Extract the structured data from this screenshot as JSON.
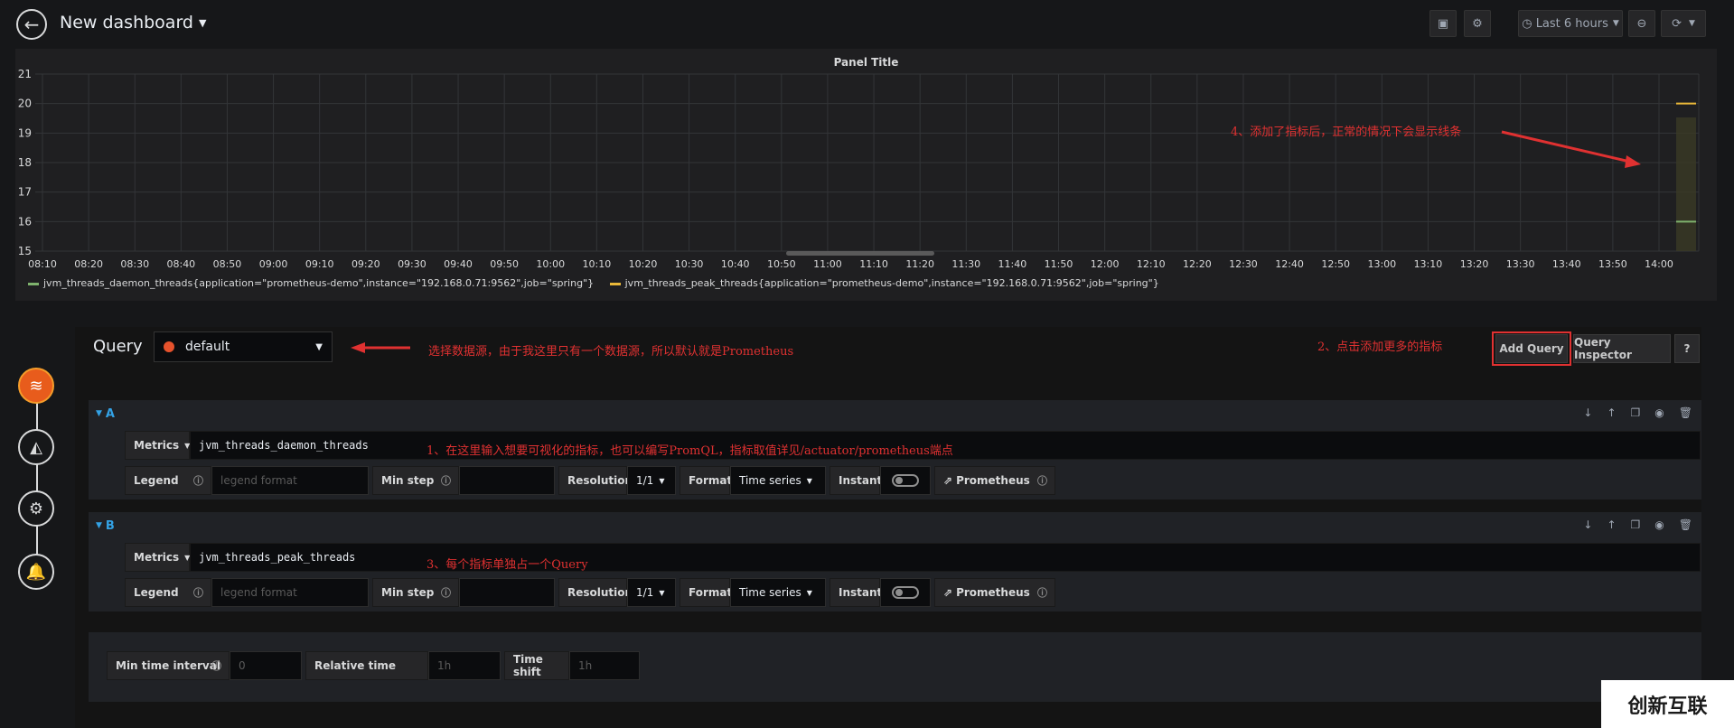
{
  "topbar": {
    "title": "New dashboard",
    "time_range": "Last 6 hours"
  },
  "panel": {
    "title": "Panel Title"
  },
  "chart_data": {
    "type": "line",
    "x": [
      "08:10",
      "08:20",
      "08:30",
      "08:40",
      "08:50",
      "09:00",
      "09:10",
      "09:20",
      "09:30",
      "09:40",
      "09:50",
      "10:00",
      "10:10",
      "10:20",
      "10:30",
      "10:40",
      "10:50",
      "11:00",
      "11:10",
      "11:20",
      "11:30",
      "11:40",
      "11:50",
      "12:00",
      "12:10",
      "12:20",
      "12:30",
      "12:40",
      "12:50",
      "13:00",
      "13:10",
      "13:20",
      "13:30",
      "13:40",
      "13:50",
      "14:00"
    ],
    "ylim": [
      15,
      21
    ],
    "yticks": [
      15,
      16,
      17,
      18,
      19,
      20,
      21
    ],
    "grid": true,
    "legend_position": "bottom",
    "series": [
      {
        "name": "jvm_threads_daemon_threads{application=\"prometheus-demo\",instance=\"192.168.0.71:9562\",job=\"spring\"}",
        "color": "#7eb26d",
        "values": [
          16,
          16
        ]
      },
      {
        "name": "jvm_threads_peak_threads{application=\"prometheus-demo\",instance=\"192.168.0.71:9562\",job=\"spring\"}",
        "color": "#eab839",
        "values": [
          20,
          20
        ]
      }
    ]
  },
  "annotations": {
    "chart_note": "4、添加了指标后，正常的情况下会显示线条",
    "datasource_note": "选择数据源，由于我这里只有一个数据源，所以默认就是Prometheus",
    "add_query_note": "2、点击添加更多的指标",
    "metrics_note": "1、在这里输入想要可视化的指标，也可以编写PromQL，指标取值详见/actuator/prometheus端点",
    "query_note": "3、每个指标单独占一个Query"
  },
  "editor": {
    "query_label": "Query",
    "datasource": "default",
    "add_query": "Add Query",
    "query_inspector": "Query Inspector",
    "help": "?"
  },
  "labels": {
    "metrics": "Metrics",
    "legend": "Legend",
    "legend_placeholder": "legend format",
    "min_step": "Min step",
    "resolution": "Resolution",
    "format": "Format",
    "instant": "Instant",
    "prometheus": "Prometheus"
  },
  "queries": [
    {
      "ref": "A",
      "metric": "jvm_threads_daemon_threads",
      "resolution": "1/1",
      "format": "Time series"
    },
    {
      "ref": "B",
      "metric": "jvm_threads_peak_threads",
      "resolution": "1/1",
      "format": "Time series"
    }
  ],
  "options": {
    "min_interval_label": "Min time interval",
    "min_interval_placeholder": "0",
    "relative_time_label": "Relative time",
    "relative_time_placeholder": "1h",
    "time_shift_label": "Time shift",
    "time_shift_placeholder": "1h"
  },
  "watermark": "创新互联"
}
